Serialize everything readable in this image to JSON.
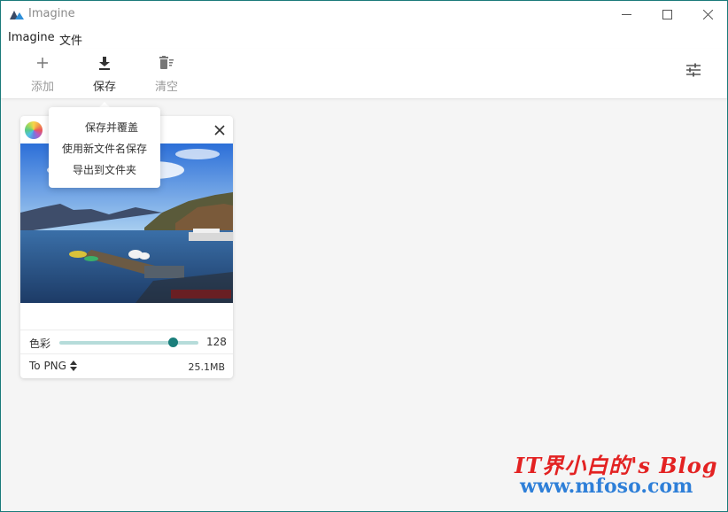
{
  "window": {
    "title": "Imagine",
    "border_color": "#1a7a7a"
  },
  "menu": {
    "items": [
      "Imagine",
      "文件"
    ]
  },
  "toolbar": {
    "add_label": "添加",
    "save_label": "保存",
    "clear_label": "清空",
    "icons": [
      "plus-icon",
      "download-icon",
      "trash-icon",
      "settings-sliders-icon"
    ]
  },
  "save_menu": {
    "items": [
      "保存并覆盖",
      "使用新文件名保存",
      "导出到文件夹"
    ]
  },
  "card": {
    "color_label": "色彩",
    "color_value": "128",
    "color_level_fraction": 0.82,
    "format_label": "To PNG",
    "file_size": "25.1MB",
    "accent_color": "#1a7e7b"
  },
  "watermark": {
    "line1": "IT界小白的's Blog",
    "line2": "www.mfoso.com"
  }
}
